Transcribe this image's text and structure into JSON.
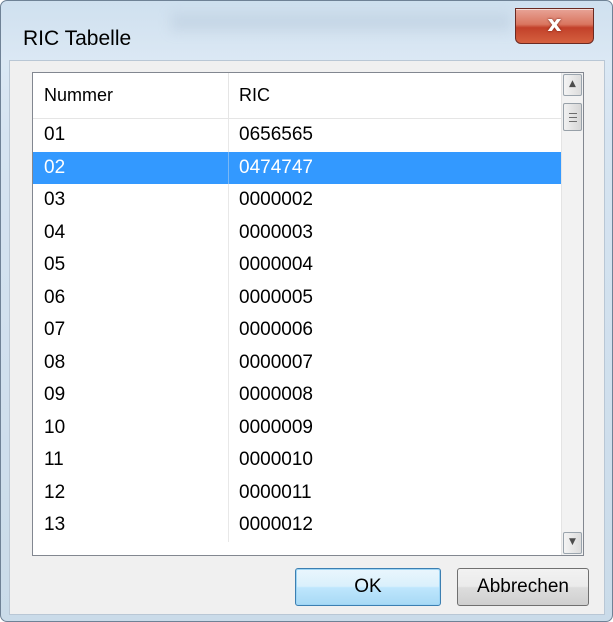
{
  "window": {
    "title": "RIC Tabelle",
    "close_glyph": "x"
  },
  "list": {
    "columns": [
      "Nummer",
      "RIC"
    ],
    "rows": [
      {
        "nummer": "01",
        "ric": "0656565",
        "selected": false
      },
      {
        "nummer": "02",
        "ric": "0474747",
        "selected": true
      },
      {
        "nummer": "03",
        "ric": "0000002",
        "selected": false
      },
      {
        "nummer": "04",
        "ric": "0000003",
        "selected": false
      },
      {
        "nummer": "05",
        "ric": "0000004",
        "selected": false
      },
      {
        "nummer": "06",
        "ric": "0000005",
        "selected": false
      },
      {
        "nummer": "07",
        "ric": "0000006",
        "selected": false
      },
      {
        "nummer": "08",
        "ric": "0000007",
        "selected": false
      },
      {
        "nummer": "09",
        "ric": "0000008",
        "selected": false
      },
      {
        "nummer": "10",
        "ric": "0000009",
        "selected": false
      },
      {
        "nummer": "11",
        "ric": "0000010",
        "selected": false
      },
      {
        "nummer": "12",
        "ric": "0000011",
        "selected": false
      },
      {
        "nummer": "13",
        "ric": "0000012",
        "selected": false
      }
    ],
    "scroll_up_icon": "triangle-up",
    "scroll_down_icon": "triangle-down",
    "selection_color": "#3399ff"
  },
  "buttons": {
    "ok_label": "OK",
    "cancel_label": "Abbrechen"
  }
}
